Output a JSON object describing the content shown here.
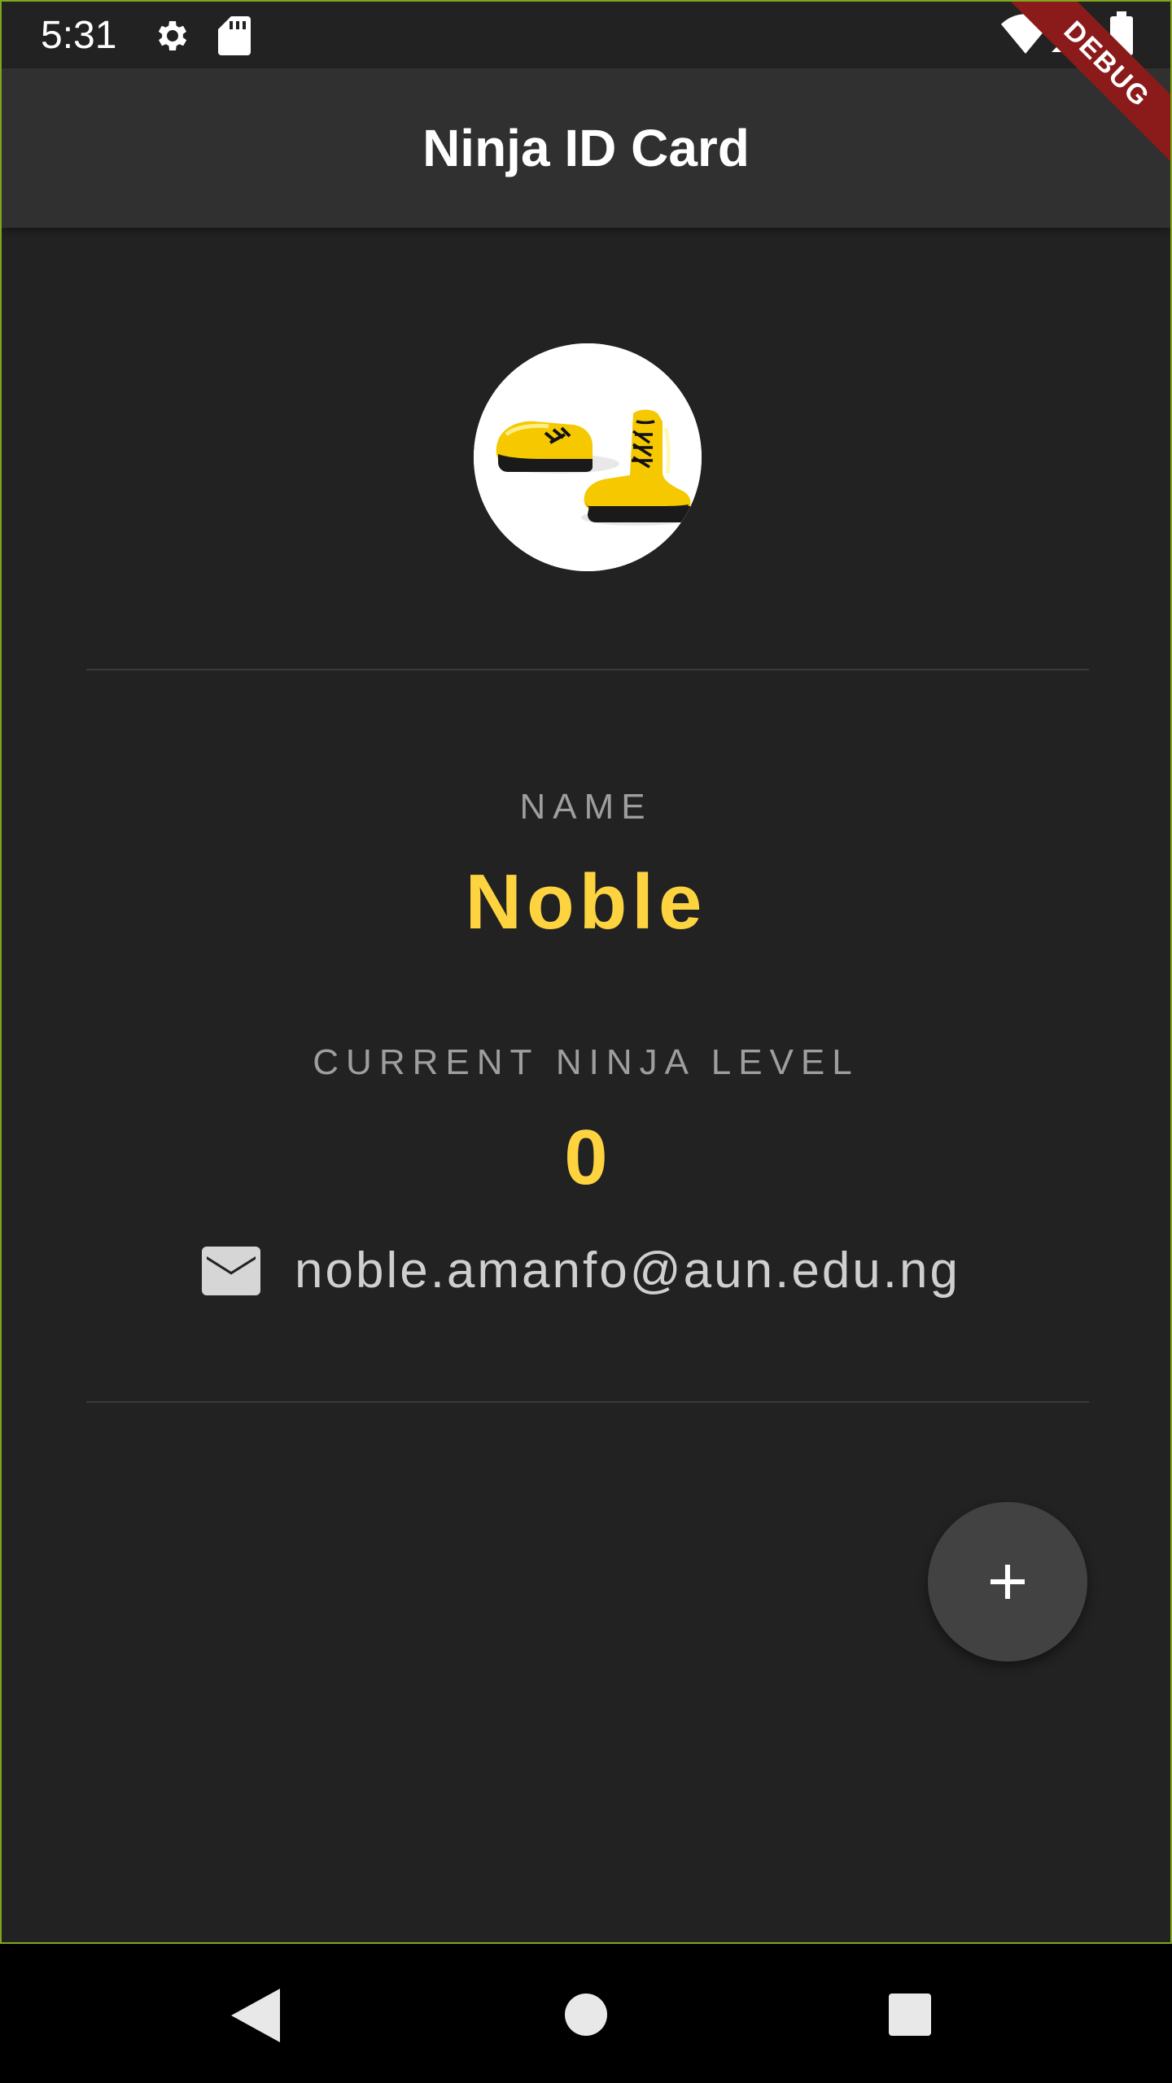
{
  "status_bar": {
    "time": "5:31",
    "icons": [
      "gear-icon",
      "sd-card-icon",
      "wifi-icon",
      "signal-icon",
      "battery-icon"
    ]
  },
  "app_bar": {
    "title": "Ninja ID Card"
  },
  "debug_banner": {
    "label": "DEBUG"
  },
  "profile": {
    "avatar_alt": "yellow-boots-image",
    "name_label": "NAME",
    "name_value": "Noble",
    "level_label": "CURRENT NINJA LEVEL",
    "level_value": "0",
    "email": "noble.amanfo@aun.edu.ng"
  },
  "fab": {
    "icon": "plus-icon"
  },
  "navigation": {
    "buttons": [
      "back-icon",
      "home-icon",
      "recents-icon"
    ]
  },
  "colors": {
    "background": "#222222",
    "app_bar": "#303030",
    "accent": "#fdd33f",
    "label_grey": "#9e9e9e",
    "fab": "#424242",
    "debug_banner": "#8b1b1b",
    "frame_border": "#7fa61e"
  }
}
